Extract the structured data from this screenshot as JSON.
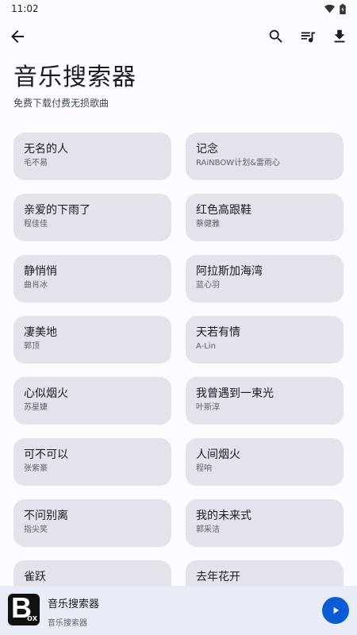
{
  "status_bar": {
    "time": "11:02"
  },
  "header": {
    "title": "音乐搜索器",
    "subtitle": "免费下载付费无损歌曲"
  },
  "songs": [
    {
      "title": "无名的人",
      "artist": "毛不易"
    },
    {
      "title": "记念",
      "artist": "RAiNBOW计划&雷雨心"
    },
    {
      "title": "亲爱的下雨了",
      "artist": "程佳佳"
    },
    {
      "title": "红色高跟鞋",
      "artist": "蔡健雅"
    },
    {
      "title": "静悄悄",
      "artist": "曲肖冰"
    },
    {
      "title": "阿拉斯加海湾",
      "artist": "蓝心羽"
    },
    {
      "title": "凄美地",
      "artist": "郭顶"
    },
    {
      "title": "天若有情",
      "artist": "A-Lin"
    },
    {
      "title": "心似烟火",
      "artist": "苏星婕"
    },
    {
      "title": "我曾遇到一束光",
      "artist": "叶斯淳"
    },
    {
      "title": "可不可以",
      "artist": "张紫豪"
    },
    {
      "title": "人间烟火",
      "artist": "程响"
    },
    {
      "title": "不问别离",
      "artist": "指尖笑"
    },
    {
      "title": "我的未来式",
      "artist": "郭采洁"
    },
    {
      "title": "雀跃",
      "artist": ""
    },
    {
      "title": "去年花开",
      "artist": ""
    }
  ],
  "player": {
    "logo_letter": "B",
    "logo_suffix": "ox",
    "title": "音乐搜索器",
    "subtitle": "音乐搜索器"
  },
  "colors": {
    "accent": "#0b5bd3",
    "card_bg": "#e4e2ea",
    "player_bg": "#e7ecf7"
  }
}
